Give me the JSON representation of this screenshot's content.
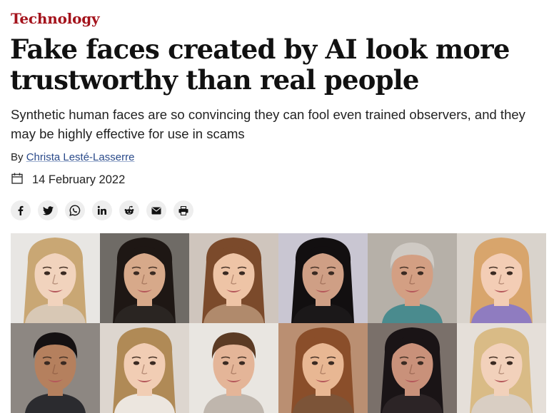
{
  "section": {
    "label": "Technology"
  },
  "article": {
    "headline": "Fake faces created by AI look more trustworthy than real people",
    "standfirst": "Synthetic human faces are so convincing they can fool even trained observers, and they may be highly effective for use in scams",
    "byline_prefix": "By ",
    "author": "Christa Lesté-Lasserre",
    "date": "14 February 2022"
  },
  "share_buttons": [
    {
      "name": "facebook",
      "icon": "facebook-icon"
    },
    {
      "name": "twitter",
      "icon": "twitter-icon"
    },
    {
      "name": "whatsapp",
      "icon": "whatsapp-icon"
    },
    {
      "name": "linkedin",
      "icon": "linkedin-icon"
    },
    {
      "name": "reddit",
      "icon": "reddit-icon"
    },
    {
      "name": "email",
      "icon": "email-icon"
    },
    {
      "name": "print",
      "icon": "print-icon"
    }
  ],
  "colors": {
    "section": "#a4131c",
    "link": "#2a4a8a",
    "share_bg": "#eeeeee"
  },
  "image": {
    "description_icon": "face-grid-image",
    "faces": [
      {
        "bg": "#e8e6e3",
        "skin": "#f1d3bd",
        "hair": "#c9a774",
        "hair_style": "long",
        "shirt": "#d8c8b5"
      },
      {
        "bg": "#6f6b66",
        "skin": "#d7a98a",
        "hair": "#1e1714",
        "hair_style": "long",
        "shirt": "#2a2522"
      },
      {
        "bg": "#cfc5bd",
        "skin": "#eec4a6",
        "hair": "#7b4a2b",
        "hair_style": "long",
        "shirt": "#b08a6c"
      },
      {
        "bg": "#c9c6d2",
        "skin": "#cf9f85",
        "hair": "#120f10",
        "hair_style": "long",
        "shirt": "#1b1819"
      },
      {
        "bg": "#b6b0a8",
        "skin": "#d39f83",
        "hair": "#cfcac4",
        "hair_style": "short",
        "shirt": "#4a8b8e"
      },
      {
        "bg": "#d9d3cc",
        "skin": "#f3cdb5",
        "hair": "#d8a56c",
        "hair_style": "long",
        "shirt": "#8f7cc0"
      },
      {
        "bg": "#8d8782",
        "skin": "#b5805e",
        "hair": "#151112",
        "hair_style": "short",
        "shirt": "#2b2b2f"
      },
      {
        "bg": "#ddd6cf",
        "skin": "#f1cdb4",
        "hair": "#b08a56",
        "hair_style": "long",
        "shirt": "#ece6df"
      },
      {
        "bg": "#e9e6e1",
        "skin": "#e4b598",
        "hair": "#5b3b24",
        "hair_style": "short",
        "shirt": "#bfb6ad"
      },
      {
        "bg": "#ba8f72",
        "skin": "#e8b793",
        "hair": "#8a4e2a",
        "hair_style": "long",
        "shirt": "#7c5438"
      },
      {
        "bg": "#7a706a",
        "skin": "#c9917a",
        "hair": "#1a1416",
        "hair_style": "long",
        "shirt": "#2c2426"
      },
      {
        "bg": "#e5dfd9",
        "skin": "#f2d1bb",
        "hair": "#d9bb86",
        "hair_style": "long",
        "shirt": "#d9cec3"
      }
    ]
  }
}
